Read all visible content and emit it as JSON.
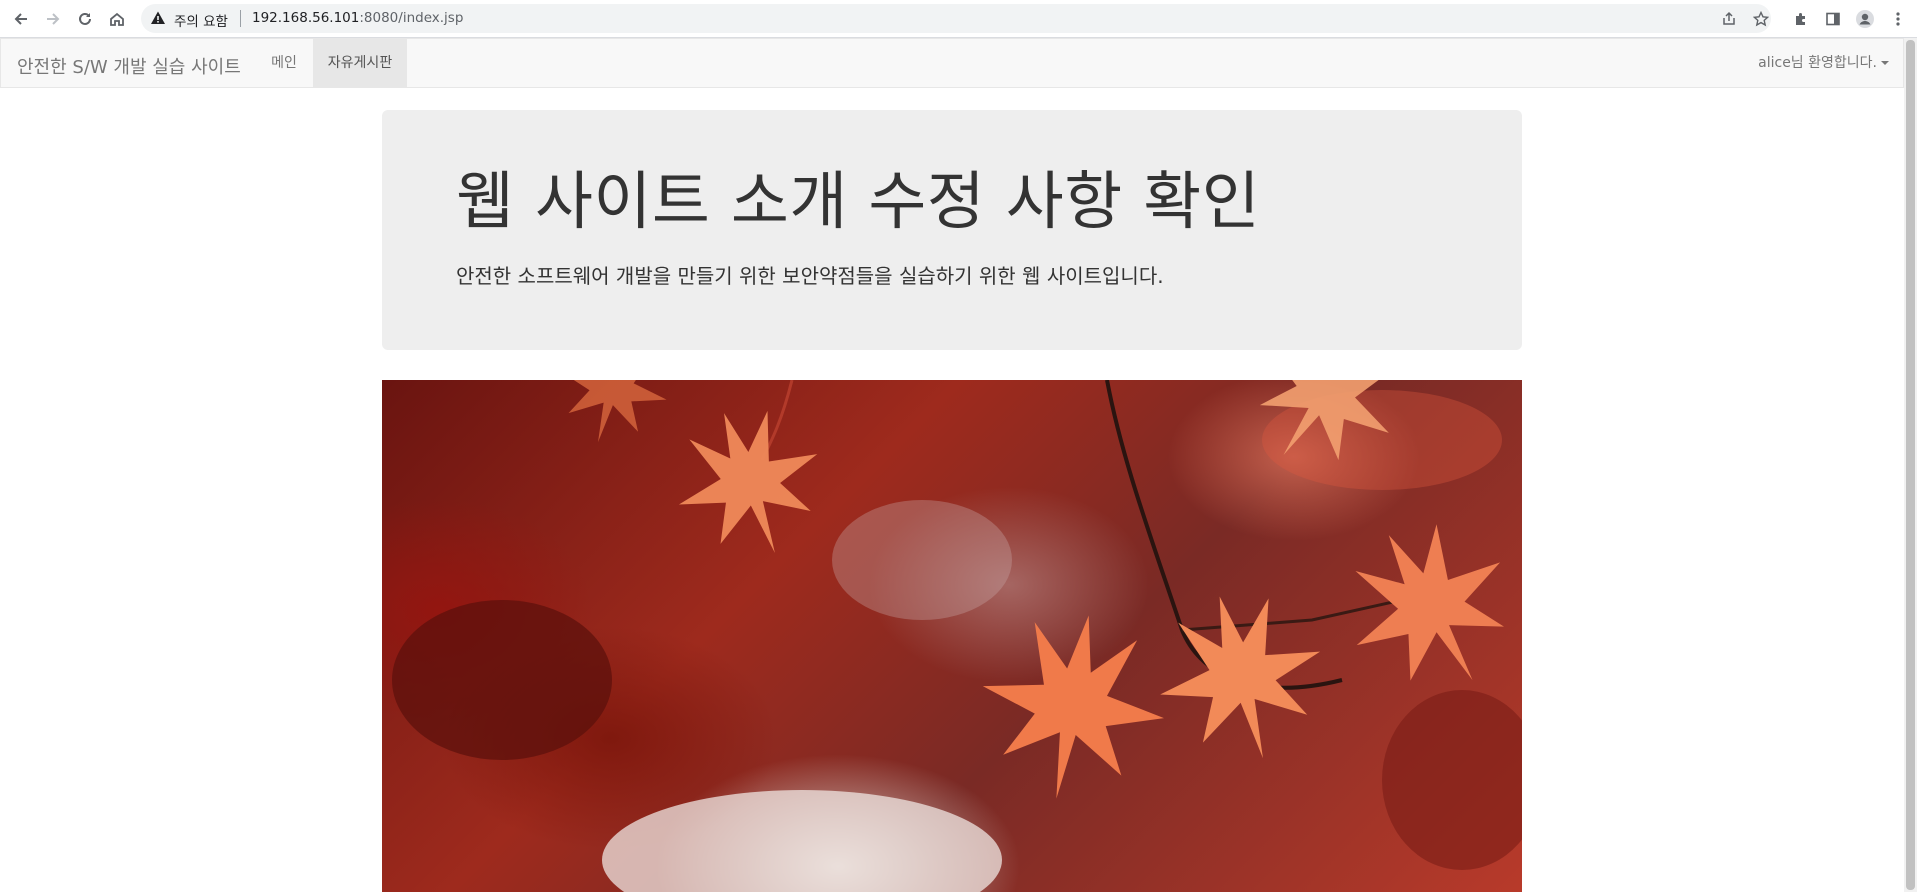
{
  "browser": {
    "security_label": "주의 요함",
    "url_host": "192.168.56.101",
    "url_path": ":8080/index.jsp",
    "icons": {
      "back": "arrow-left-icon",
      "forward": "arrow-right-icon",
      "reload": "reload-icon",
      "home": "home-icon",
      "warning": "warning-icon",
      "share": "share-icon",
      "bookmark": "star-icon",
      "extensions": "puzzle-icon",
      "side_panel": "side-panel-icon",
      "profile": "profile-icon",
      "menu": "kebab-menu-icon"
    }
  },
  "navbar": {
    "brand": "안전한 S/W 개발 실습 사이트",
    "items": [
      {
        "label": "메인",
        "active": false
      },
      {
        "label": "자유게시판",
        "active": true
      }
    ],
    "user_menu": "alice님 환영합니다."
  },
  "jumbotron": {
    "title": "웹 사이트 소개 수정 사항 확인",
    "subtitle": "안전한 소프트웨어 개발을 만들기 위한 보안약점들을 실습하기 위한 웹 사이트입니다."
  },
  "colors": {
    "navbar_bg": "#f8f8f8",
    "jumbotron_bg": "#eeeeee",
    "leaf_orange": "#f07a4a",
    "background_red": "#9e2a1d"
  }
}
